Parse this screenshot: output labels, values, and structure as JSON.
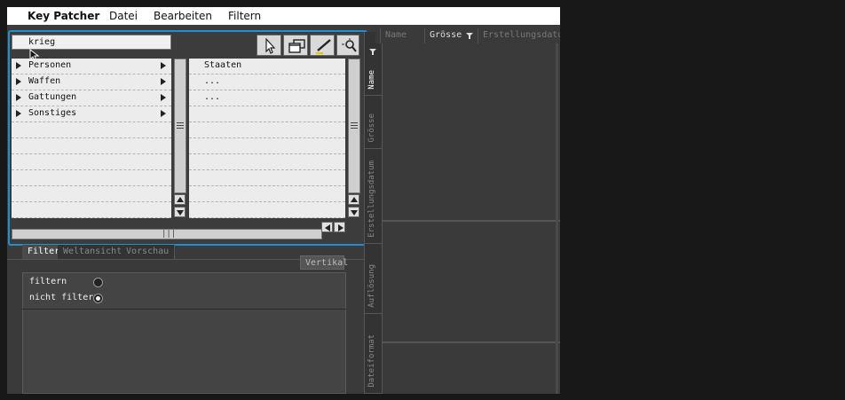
{
  "menubar": {
    "app": "Key Patcher",
    "items": [
      "Datei",
      "Bearbeiten",
      "Filtern"
    ]
  },
  "search": {
    "value": "krieg"
  },
  "tools": [
    "pointer-icon",
    "windows-icon",
    "pen-icon",
    "zoom-icon"
  ],
  "list_left": {
    "rows": [
      {
        "label": "Personen",
        "expandable": true
      },
      {
        "label": "Waffen",
        "expandable": true
      },
      {
        "label": "Gattungen",
        "expandable": true
      },
      {
        "label": "Sonstiges",
        "expandable": true
      },
      {
        "label": ""
      },
      {
        "label": ""
      },
      {
        "label": ""
      },
      {
        "label": ""
      },
      {
        "label": ""
      },
      {
        "label": ""
      }
    ]
  },
  "list_right": {
    "rows": [
      {
        "label": "Staaten"
      },
      {
        "label": "..."
      },
      {
        "label": "..."
      },
      {
        "label": ""
      },
      {
        "label": ""
      },
      {
        "label": ""
      },
      {
        "label": ""
      },
      {
        "label": ""
      },
      {
        "label": ""
      },
      {
        "label": ""
      }
    ]
  },
  "hscroll_grip": "|||",
  "tabs": [
    {
      "label": "Filter",
      "active": true
    },
    {
      "label": "Weltansicht",
      "active": false
    },
    {
      "label": "Vorschau",
      "active": false
    }
  ],
  "vertikal_label": "Vertikal",
  "filter_options": [
    {
      "label": "filtern",
      "selected": false
    },
    {
      "label": "nicht filtern",
      "selected": true
    }
  ],
  "vertical_tabs": [
    {
      "label": "Name",
      "active": true
    },
    {
      "label": "Grösse",
      "active": false
    },
    {
      "label": "Erstellungsdatum",
      "active": false
    },
    {
      "label": "Auflösung",
      "active": false
    },
    {
      "label": "Dateiformat",
      "active": false
    }
  ],
  "column_headers": [
    {
      "label": "Name",
      "active": false
    },
    {
      "label": "Grösse",
      "active": true
    },
    {
      "label": "Erstellungsdatum",
      "active": false
    }
  ],
  "colors": {
    "selection_border": "#1f8fcf",
    "panel_bg": "#3a3a3a",
    "list_bg": "#ececec"
  }
}
